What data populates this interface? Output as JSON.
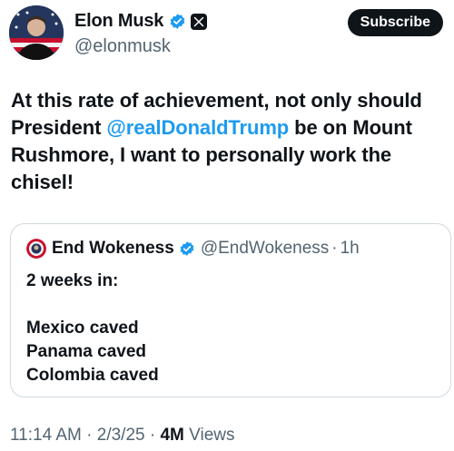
{
  "author": {
    "display_name": "Elon Musk",
    "handle": "@elonmusk"
  },
  "subscribe_label": "Subscribe",
  "tweet": {
    "text_before": "At this rate of achievement, not only should President ",
    "mention": "@realDonaldTrump",
    "text_after": " be on Mount Rushmore, I want to personally work the chisel!"
  },
  "quoted": {
    "display_name": "End Wokeness",
    "handle": "@EndWokeness",
    "separator": "·",
    "time": "1h",
    "lines": [
      "2 weeks in:",
      "",
      "Mexico caved",
      "Panama caved",
      "Colombia caved"
    ]
  },
  "meta": {
    "time": "11:14 AM",
    "sep1": "·",
    "date": "2/3/25",
    "sep2": "·",
    "views_count": "4M",
    "views_label": "Views"
  },
  "colors": {
    "link": "#1d9bf0",
    "verified": "#1d9bf0",
    "muted": "#536471",
    "text": "#0f1419"
  }
}
